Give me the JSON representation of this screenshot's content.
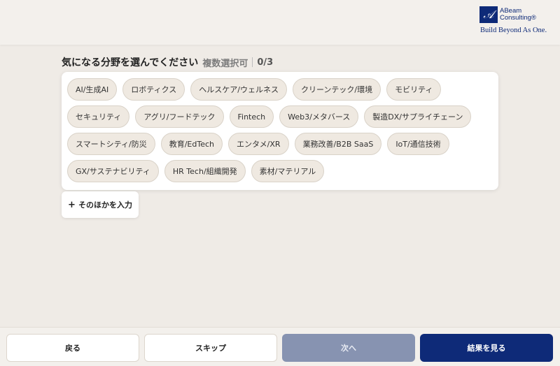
{
  "brand": {
    "mark": "𝒜",
    "name_line1": "ABeam",
    "name_line2": "Consulting®",
    "tagline": "Build Beyond As One."
  },
  "question": {
    "title": "気になる分野を選んでください",
    "mode": "複数選択可",
    "count": "0/3"
  },
  "chips": [
    "AI/生成AI",
    "ロボティクス",
    "ヘルスケア/ウェルネス",
    "クリーンテック/環境",
    "モビリティ",
    "セキュリティ",
    "アグリ/フードテック",
    "Fintech",
    "Web3/メタバース",
    "製造DX/サプライチェーン",
    "スマートシティ/防災",
    "教育/EdTech",
    "エンタメ/XR",
    "業務改善/B2B SaaS",
    "IoT/通信技術",
    "GX/サステナビリティ",
    "HR Tech/組織開発",
    "素材/マテリアル"
  ],
  "add_other": {
    "icon": "+",
    "label": "そのほかを入力"
  },
  "footer": {
    "back": "戻る",
    "skip": "スキップ",
    "next": "次へ",
    "result": "結果を見る"
  },
  "colors": {
    "background": "#efebe6",
    "accent": "#0e2a78",
    "disabled": "#8793b1",
    "chip": "#efe9e1"
  }
}
